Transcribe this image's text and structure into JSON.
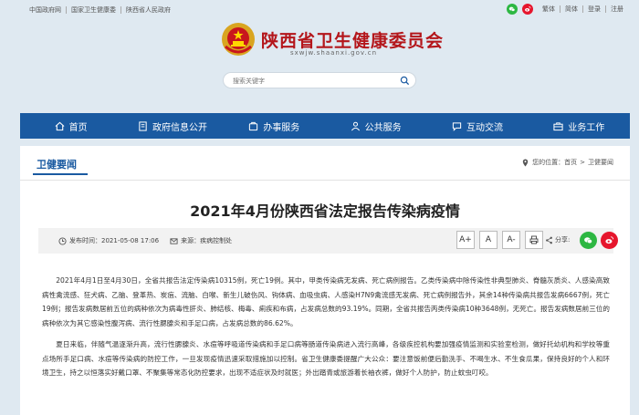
{
  "topbar": {
    "links": [
      "中国政府网",
      "国家卫生健康委",
      "陕西省人民政府"
    ],
    "right_links": [
      "繁体",
      "简体",
      "登录",
      "注册"
    ]
  },
  "header": {
    "title": "陕西省卫生健康委员会",
    "domain": "sxwjw.shaanxi.gov.cn",
    "search_placeholder": "搜索关键字"
  },
  "nav": {
    "items": [
      {
        "label": "首页",
        "icon": "home-icon"
      },
      {
        "label": "政府信息公开",
        "icon": "document-icon"
      },
      {
        "label": "办事服务",
        "icon": "service-icon"
      },
      {
        "label": "公共服务",
        "icon": "people-icon"
      },
      {
        "label": "互动交流",
        "icon": "chat-icon"
      },
      {
        "label": "业务工作",
        "icon": "briefcase-icon"
      }
    ]
  },
  "section": {
    "title": "卫健要闻",
    "breadcrumb": [
      "您的位置：",
      "首页",
      "卫健要闻"
    ]
  },
  "article": {
    "title": "2021年4月份陕西省法定报告传染病疫情",
    "date": "发布时间：2021-05-08 17:06",
    "source": "来源：疾病控制处",
    "share_label": "分享:",
    "font_buttons": [
      "A+",
      "A",
      "A-"
    ],
    "paragraphs": [
      "2021年4月1日至4月30日，全省共报告法定传染病10315例，死亡19例。其中，甲类传染病无发病、死亡病例报告。乙类传染病中除传染性非典型肺炎、脊髓灰质炎、人感染高致病性禽流感、狂犬病、乙脑、登革热、炭疽、流脑、白喉、新生儿破伤风、钩体病、血吸虫病、人感染H7N9禽流感无发病、死亡病例报告外，其余14种传染病共报告发病6667例，死亡19例；报告发病数居前五位的病种依次为病毒性肝炎、肺结核、梅毒、痢疾和布病，占发病总数的93.19%。同期，全省共报告丙类传染病10种3648例，无死亡。报告发病数居前三位的病种依次为其它感染性腹泻病、流行性腮腺炎和手足口病，占发病总数的86.62%。",
      "夏日来临，伴随气温逐渐升高，流行性腮腺炎、水痘等呼吸道传染病和手足口病等肠道传染病进入流行高峰，各级疾控机构要加强疫情监测和实验室检测，做好托幼机构和学校等重点场所手足口病、水痘等传染病的防控工作，一旦发现疫情迅速采取措施加以控制。省卫生健康委提醒广大公众：要注意饭前便后勤洗手、不喝生水、不生食瓜果，保持良好的个人和环境卫生，持之以恒落实好戴口罩、不聚集等常态化防控要求，出现不适症状及时就医；外出踏青或旅游着长袖衣裤，做好个人防护，防止蚊虫叮咬。"
    ]
  },
  "colors": {
    "nav_blue": "#1a5aa1",
    "title_red": "#b4161b",
    "wechat_green": "#2db742",
    "weibo_red": "#e6162d"
  }
}
